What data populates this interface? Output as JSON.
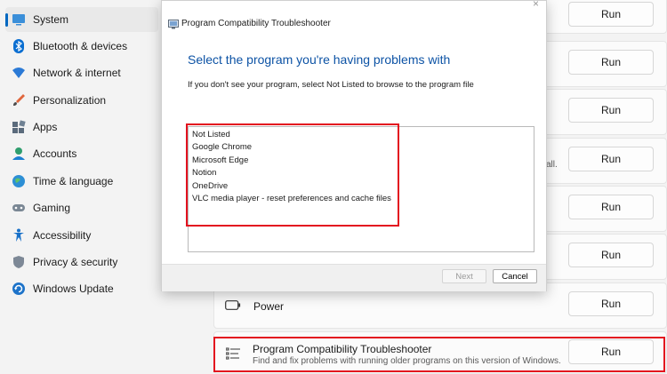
{
  "sidebar": {
    "items": [
      {
        "label": "System",
        "icon": "system-icon",
        "active": true
      },
      {
        "label": "Bluetooth & devices",
        "icon": "bluetooth-icon"
      },
      {
        "label": "Network & internet",
        "icon": "wifi-icon"
      },
      {
        "label": "Personalization",
        "icon": "brush-icon"
      },
      {
        "label": "Apps",
        "icon": "apps-icon"
      },
      {
        "label": "Accounts",
        "icon": "person-icon"
      },
      {
        "label": "Time & language",
        "icon": "globe-icon"
      },
      {
        "label": "Gaming",
        "icon": "gamepad-icon"
      },
      {
        "label": "Accessibility",
        "icon": "accessibility-icon"
      },
      {
        "label": "Privacy & security",
        "icon": "shield-icon"
      },
      {
        "label": "Windows Update",
        "icon": "update-icon"
      }
    ]
  },
  "content": {
    "run_label": "Run",
    "fragment_text": "all.",
    "power": {
      "title": "Power"
    },
    "compat": {
      "title": "Program Compatibility Troubleshooter",
      "subtitle": "Find and fix problems with running older programs on this version of Windows."
    }
  },
  "dialog": {
    "title": "Program Compatibility Troubleshooter",
    "close_glyph": "×",
    "heading": "Select the program you're having problems with",
    "instruction": "If you don't see your program, select Not Listed to browse to the program file",
    "programs": [
      "Not Listed",
      "Google Chrome",
      "Microsoft Edge",
      "Notion",
      "OneDrive",
      "VLC media player - reset preferences and cache files"
    ],
    "next_label": "Next",
    "cancel_label": "Cancel"
  },
  "colors": {
    "accent": "#0067c0",
    "heading": "#0d53a5",
    "highlight": "#e3121f"
  }
}
